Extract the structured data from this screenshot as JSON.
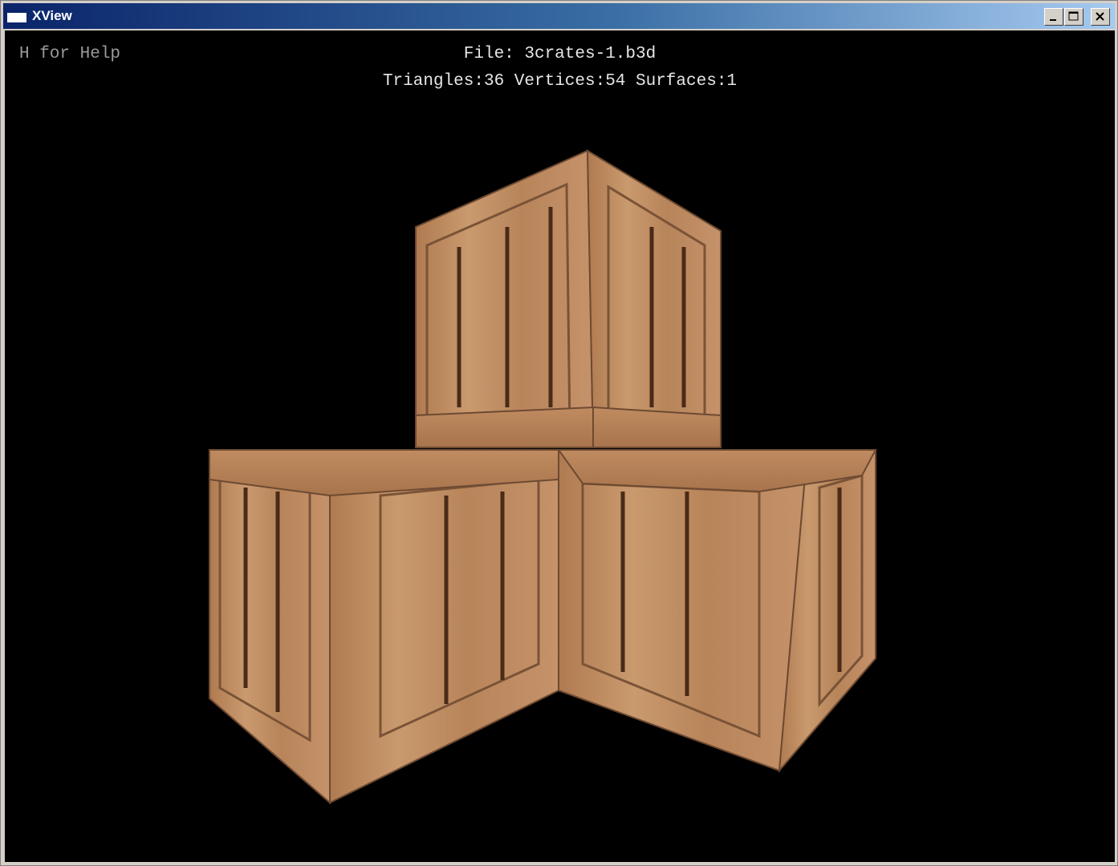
{
  "window": {
    "title": "XView",
    "icon": "app-window-icon",
    "controls": {
      "minimize": "minimize-icon",
      "maximize": "maximize-icon",
      "close": "close-icon"
    }
  },
  "hud": {
    "help": "H for Help",
    "file": "File: 3crates-1.b3d",
    "stats": "Triangles:36 Vertices:54 Surfaces:1"
  },
  "colors": {
    "background": "#000000",
    "hud_text": "#e6e6e6",
    "help_text": "#9a9a9a",
    "wood_light": "#c9966a",
    "wood_mid": "#b37f55",
    "wood_dark": "#5a3520"
  }
}
